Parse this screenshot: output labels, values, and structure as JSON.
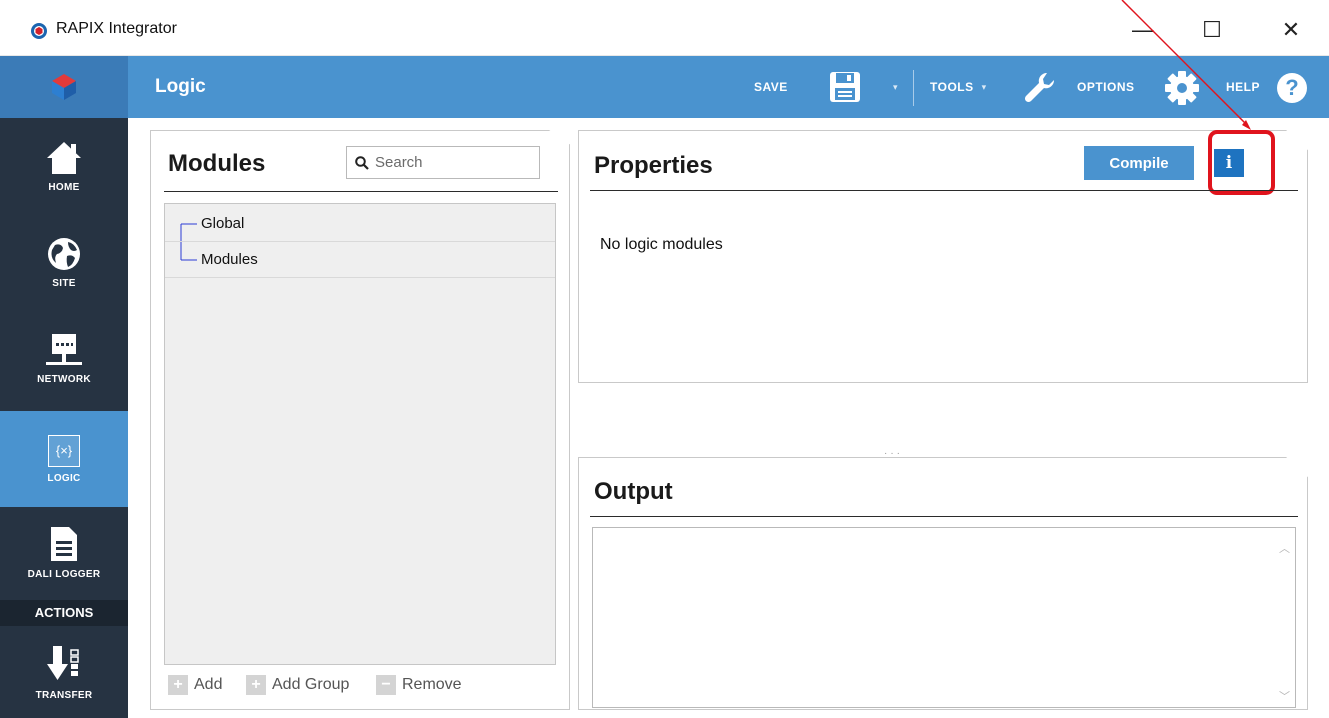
{
  "window": {
    "title": "RAPIX Integrator",
    "controls": {
      "minimize": "—",
      "maximize": "☐",
      "close": "✕"
    }
  },
  "header": {
    "page_title": "Logic",
    "save_label": "SAVE",
    "tools_label": "TOOLS",
    "options_label": "OPTIONS",
    "help_label": "HELP",
    "help_glyph": "?",
    "caret": "▾",
    "background_color": "#4a93cf"
  },
  "sidebar": {
    "items": [
      {
        "label": "HOME",
        "icon": "home-icon"
      },
      {
        "label": "SITE",
        "icon": "globe-icon"
      },
      {
        "label": "NETWORK",
        "icon": "network-icon"
      },
      {
        "label": "LOGIC",
        "icon": "logic-icon",
        "active": true,
        "glyph": "{×}"
      },
      {
        "label": "DALI LOGGER",
        "icon": "document-icon"
      }
    ],
    "actions_header": "ACTIONS",
    "actions": [
      {
        "label": "TRANSFER",
        "icon": "transfer-icon"
      }
    ]
  },
  "modules": {
    "title": "Modules",
    "search_placeholder": "Search",
    "tree": [
      {
        "label": "Global"
      },
      {
        "label": "Modules"
      }
    ],
    "add_label": "Add",
    "add_group_label": "Add Group",
    "remove_label": "Remove"
  },
  "properties": {
    "title": "Properties",
    "compile_label": "Compile",
    "info_glyph": "i",
    "empty_message": "No logic modules"
  },
  "output": {
    "title": "Output",
    "content": ""
  },
  "annotation": {
    "highlight_color": "#e0141d"
  }
}
